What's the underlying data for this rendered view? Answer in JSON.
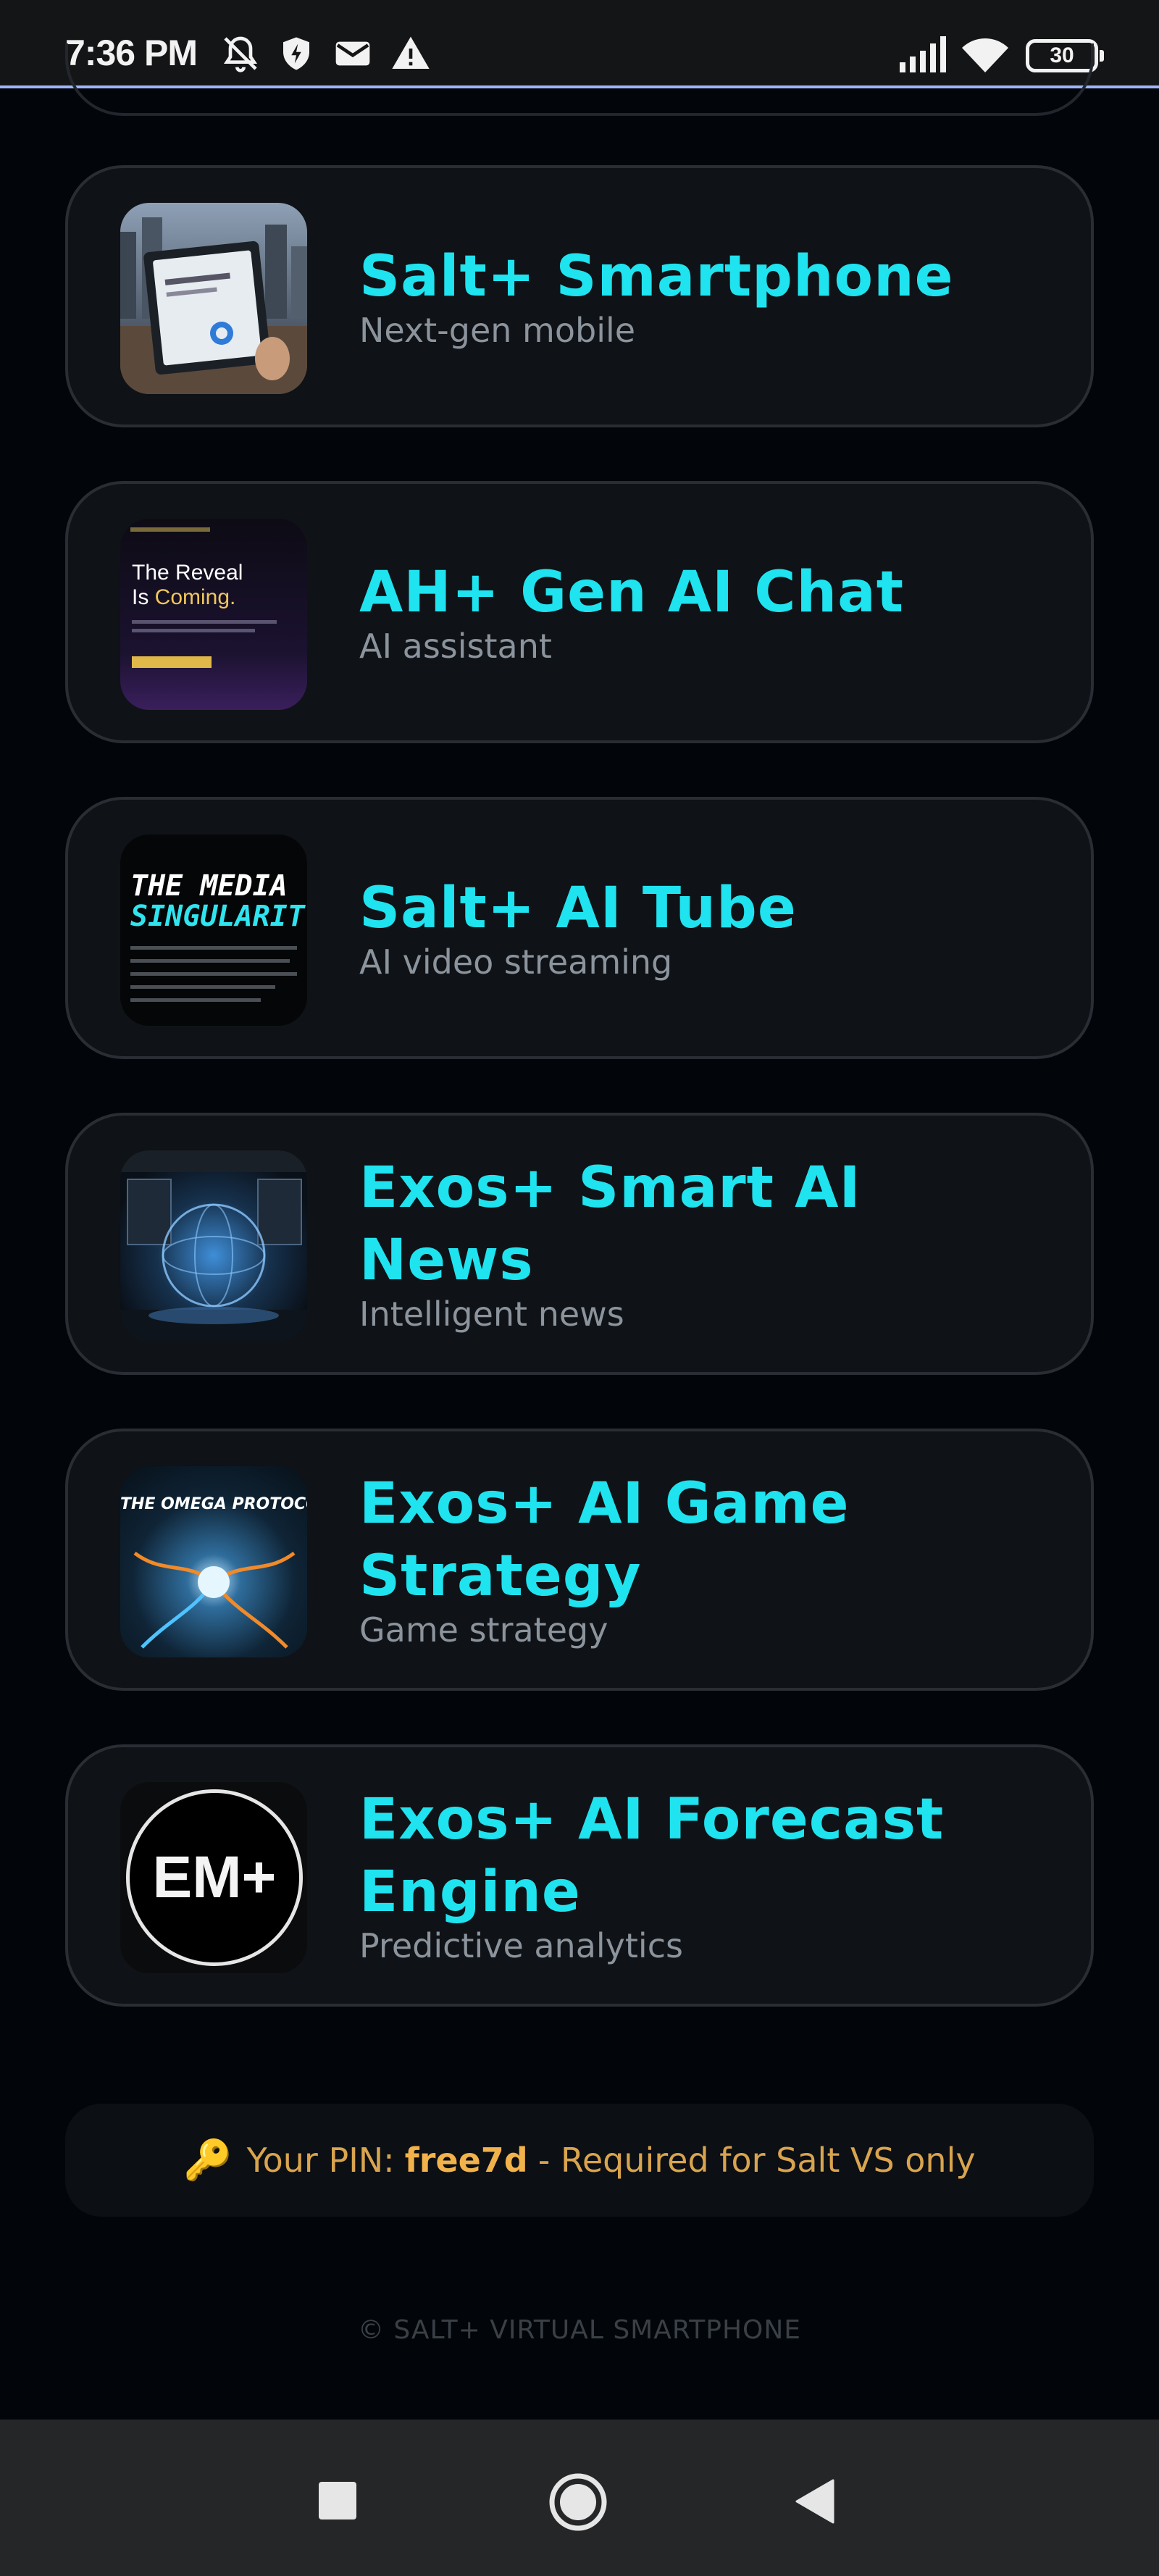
{
  "status_bar": {
    "time": "7:36 PM",
    "battery_level": "30",
    "icons": [
      "bell-off-icon",
      "shield-icon",
      "mail-icon",
      "warning-icon",
      "signal-icon",
      "wifi-icon",
      "battery-icon"
    ]
  },
  "apps": [
    {
      "title": "Salt+ Smartphone",
      "subtitle": "Next-gen mobile",
      "thumb_text": ""
    },
    {
      "title": "AH+ Gen AI Chat",
      "subtitle": "AI assistant",
      "thumb_text_1": "The Reveal",
      "thumb_text_2": "Is ",
      "thumb_text_3": "Coming."
    },
    {
      "title": "Salt+ AI Tube",
      "subtitle": "AI video streaming",
      "thumb_text_1": "THE MEDIA",
      "thumb_text_2": "SINGULARIT"
    },
    {
      "title": "Exos+ Smart AI News",
      "subtitle": "Intelligent news"
    },
    {
      "title": "Exos+ AI Game Strategy",
      "subtitle": "Game strategy",
      "thumb_text_1": "THE OMEGA PROTOCOL"
    },
    {
      "title": "Exos+ AI Forecast Engine",
      "subtitle": "Predictive analytics",
      "thumb_text_1": "EM+"
    }
  ],
  "pin": {
    "prefix": "Your PIN:",
    "value": "free7d",
    "suffix": "- Required for Salt VS only"
  },
  "footer": "© SALT+ VIRTUAL SMARTPHONE",
  "colors": {
    "accent": "#1fe3ef",
    "pin": "#d9a44f",
    "background": "#02060b"
  }
}
